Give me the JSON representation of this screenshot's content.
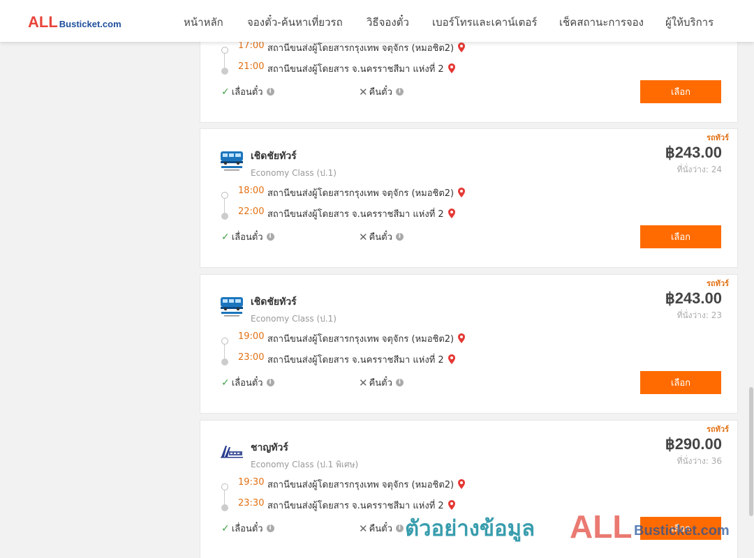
{
  "header": {
    "logo_all": "ALL",
    "logo_busticket": "Busticket.com",
    "nav": [
      "หน้าหลัก",
      "จองตั๋ว-ค้นหาเที่ยวรถ",
      "วิธีจองตั๋ว",
      "เบอร์โทรและเคาน์เตอร์",
      "เช็คสถานะการจอง",
      "ผู้ให้บริการ"
    ]
  },
  "cards": [
    {
      "departure_time": "17:00",
      "departure_station": "สถานีขนส่งผู้โดยสารกรุงเทพ จตุจักร (หมอชิต2)",
      "arrival_time": "21:00",
      "arrival_station": "สถานีขนส่งผู้โดยสาร จ.นครราชสีมา แห่งที่ 2",
      "reschedule": "เลื่อนตั๋ว",
      "refund": "คืนตั๋ว",
      "button": "เลือก"
    },
    {
      "badge": "รถทัวร์",
      "company": "เชิดชัยทัวร์",
      "bus_class": "Economy Class (ป.1)",
      "price": "฿243.00",
      "seats": "ที่นั่งว่าง: 24",
      "departure_time": "18:00",
      "departure_station": "สถานีขนส่งผู้โดยสารกรุงเทพ จตุจักร (หมอชิต2)",
      "arrival_time": "22:00",
      "arrival_station": "สถานีขนส่งผู้โดยสาร จ.นครราชสีมา แห่งที่ 2",
      "reschedule": "เลื่อนตั๋ว",
      "refund": "คืนตั๋ว",
      "button": "เลือก"
    },
    {
      "badge": "รถทัวร์",
      "company": "เชิดชัยทัวร์",
      "bus_class": "Economy Class (ป.1)",
      "price": "฿243.00",
      "seats": "ที่นั่งว่าง: 23",
      "departure_time": "19:00",
      "departure_station": "สถานีขนส่งผู้โดยสารกรุงเทพ จตุจักร (หมอชิต2)",
      "arrival_time": "23:00",
      "arrival_station": "สถานีขนส่งผู้โดยสาร จ.นครราชสีมา แห่งที่ 2",
      "reschedule": "เลื่อนตั๋ว",
      "refund": "คืนตั๋ว",
      "button": "เลือก"
    },
    {
      "badge": "รถทัวร์",
      "company": "ชาญทัวร์",
      "bus_class": "Economy Class (ป.1 พิเศษ)",
      "price": "฿290.00",
      "seats": "ที่นั่งว่าง: 36",
      "departure_time": "19:30",
      "departure_station": "สถานีขนส่งผู้โดยสารกรุงเทพ จตุจักร (หมอชิต2)",
      "arrival_time": "23:30",
      "arrival_station": "สถานีขนส่งผู้โดยสาร จ.นครราชสีมา แห่งที่ 2",
      "reschedule": "เลื่อนตั๋ว",
      "refund": "คืนตั๋ว",
      "button": "เลือก"
    }
  ],
  "watermark": {
    "text": "ตัวอย่างข้อมูล",
    "all": "ALL",
    "busticket": "Busticket.com"
  },
  "colors": {
    "accent": "#ff6b00",
    "time": "#e27012",
    "check": "#43a047",
    "pin": "#e53935"
  },
  "icons": {
    "pin": "map-pin-icon",
    "check": "check-icon",
    "cross": "cross-icon",
    "info": "info-icon"
  }
}
